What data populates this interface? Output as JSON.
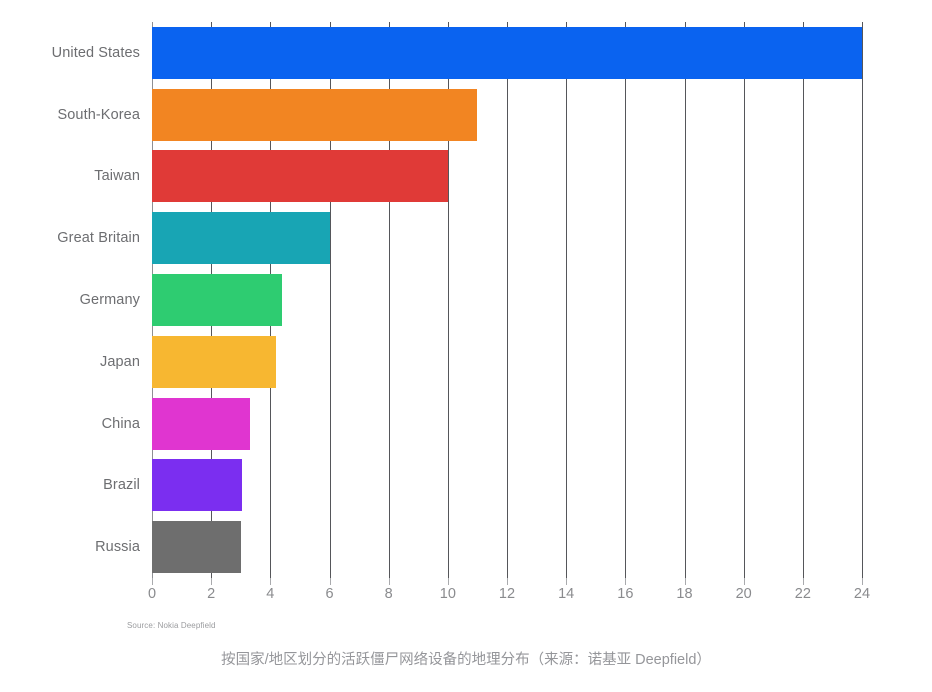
{
  "chart_data": {
    "type": "bar",
    "orientation": "horizontal",
    "title": "",
    "subtitle": "",
    "xlabel": "",
    "ylabel": "",
    "categories": [
      "United States",
      "South-Korea",
      "Taiwan",
      "Great Britain",
      "Germany",
      "Japan",
      "China",
      "Brazil",
      "Russia"
    ],
    "values": [
      24,
      11,
      10,
      6,
      4.4,
      4.2,
      3.3,
      3.05,
      3
    ],
    "colors": [
      "#0a63f0",
      "#f28522",
      "#e03a37",
      "#18a5b4",
      "#2ecc71",
      "#f7b731",
      "#e035d0",
      "#7b2ef0",
      "#6e6e6e"
    ],
    "xlim": [
      0,
      24
    ],
    "xticks": [
      0,
      2,
      4,
      6,
      8,
      10,
      12,
      14,
      16,
      18,
      20,
      22,
      24
    ],
    "xtick_labels": [
      "0",
      "2",
      "4",
      "6",
      "8",
      "10",
      "12",
      "14",
      "16",
      "18",
      "20",
      "22",
      "24"
    ],
    "grid": true,
    "grid_axis": "x",
    "legend": false,
    "source_note": "Source: Nokia Deepfield"
  },
  "caption": "按国家/地区划分的活跃僵尸网络设备的地理分布（来源：诺基亚 Deepfield）"
}
